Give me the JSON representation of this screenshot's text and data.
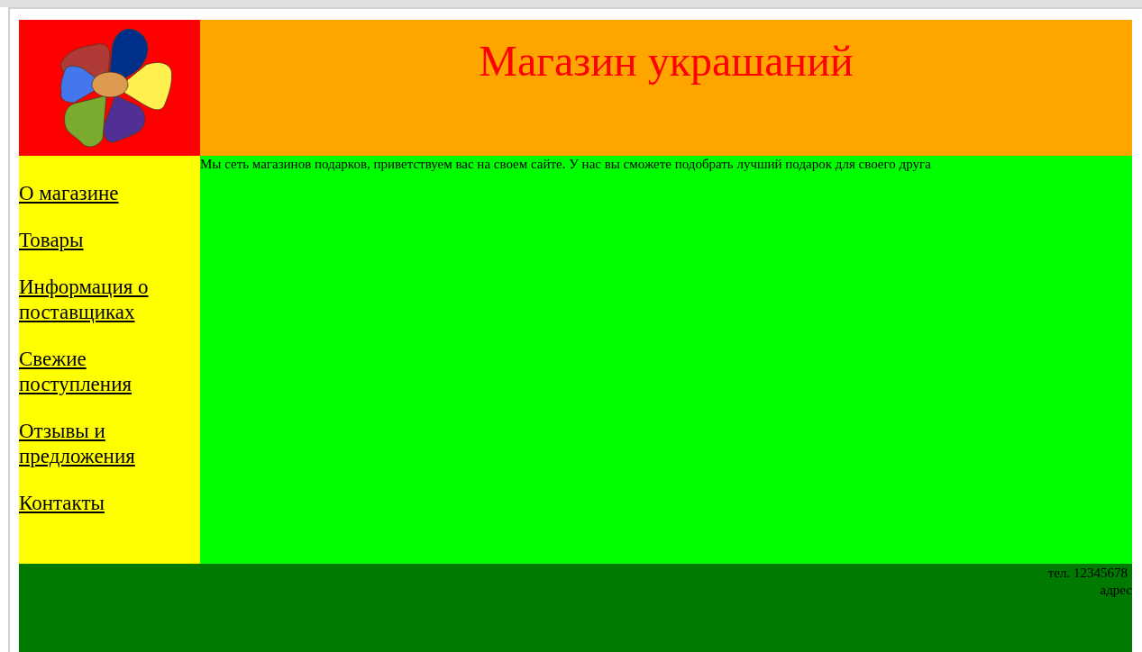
{
  "header": {
    "title": "Магазин украшаний"
  },
  "nav": [
    {
      "label": "О магазине"
    },
    {
      "label": "Товары"
    },
    {
      "label": "Информация о поставщиках"
    },
    {
      "label": "Свежие поступления"
    },
    {
      "label": "Отзывы и предложения"
    },
    {
      "label": "Контакты"
    }
  ],
  "content": {
    "text": "Мы сеть магазинов подарков, приветствуем вас на своем сайте. У нас вы сможете подобрать лучший подарок для своего друга"
  },
  "footer": {
    "phone": "тел. 12345678",
    "address": "адрес"
  }
}
